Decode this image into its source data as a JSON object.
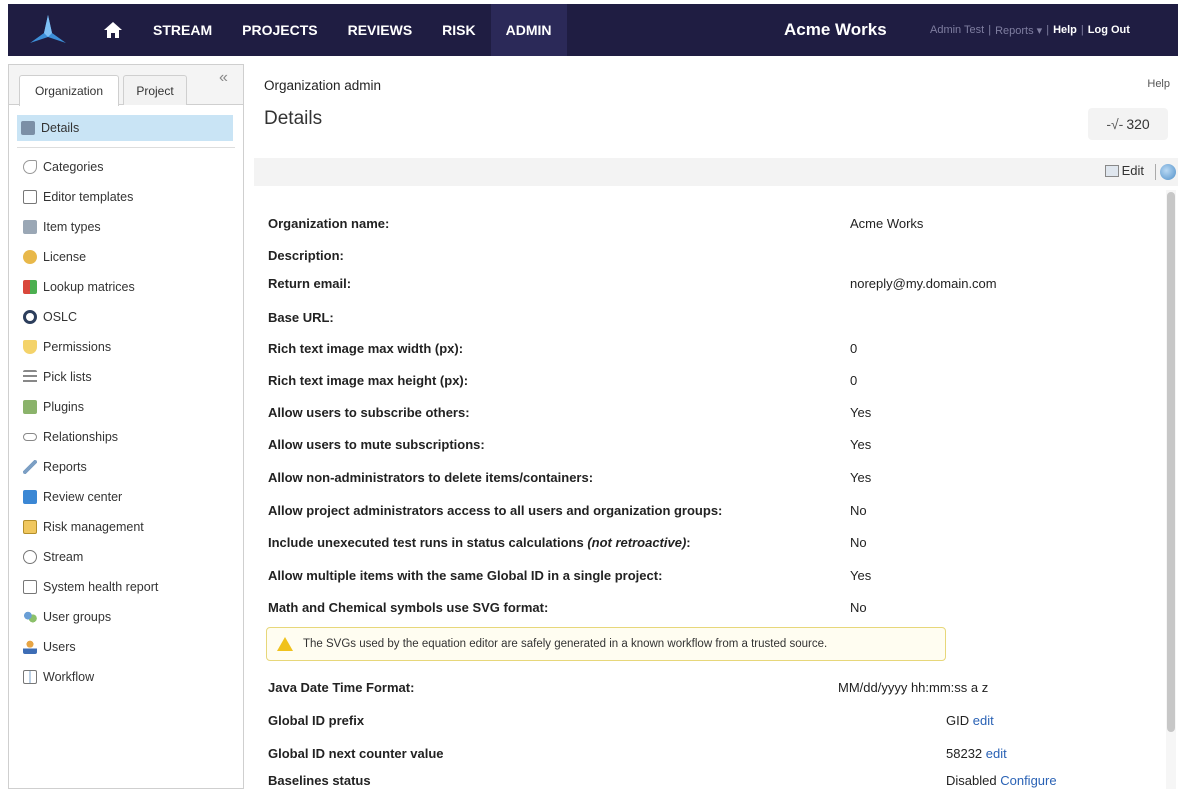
{
  "topbar": {
    "nav": [
      "STREAM",
      "PROJECTS",
      "REVIEWS",
      "RISK",
      "ADMIN"
    ],
    "brand": "Acme Works",
    "user": "Admin Test",
    "reports": "Reports",
    "help": "Help",
    "logout": "Log Out"
  },
  "sidebar": {
    "tabs": {
      "organization": "Organization",
      "project": "Project"
    },
    "items": [
      {
        "label": "Details",
        "icon": "details-icon"
      },
      {
        "label": "Categories",
        "icon": "categories-icon"
      },
      {
        "label": "Editor templates",
        "icon": "editor-templates-icon"
      },
      {
        "label": "Item types",
        "icon": "item-types-icon"
      },
      {
        "label": "License",
        "icon": "license-icon"
      },
      {
        "label": "Lookup matrices",
        "icon": "lookup-matrices-icon"
      },
      {
        "label": "OSLC",
        "icon": "oslc-icon"
      },
      {
        "label": "Permissions",
        "icon": "permissions-icon"
      },
      {
        "label": "Pick lists",
        "icon": "pick-lists-icon"
      },
      {
        "label": "Plugins",
        "icon": "plugins-icon"
      },
      {
        "label": "Relationships",
        "icon": "relationships-icon"
      },
      {
        "label": "Reports",
        "icon": "reports-icon"
      },
      {
        "label": "Review center",
        "icon": "review-center-icon"
      },
      {
        "label": "Risk management",
        "icon": "risk-management-icon"
      },
      {
        "label": "Stream",
        "icon": "stream-icon"
      },
      {
        "label": "System health report",
        "icon": "system-health-report-icon"
      },
      {
        "label": "User groups",
        "icon": "user-groups-icon"
      },
      {
        "label": "Users",
        "icon": "users-icon"
      },
      {
        "label": "Workflow",
        "icon": "workflow-icon"
      }
    ]
  },
  "main": {
    "breadcrumb": "Organization admin",
    "help": "Help",
    "title": "Details",
    "counter": "320",
    "edit": "Edit",
    "properties": [
      {
        "label": "Organization name:",
        "value": "Acme Works"
      },
      {
        "label": "Description:",
        "value": ""
      },
      {
        "label": "Return email:",
        "value": "noreply@my.domain.com"
      },
      {
        "label": "Base URL:",
        "value": ""
      },
      {
        "label": "Rich text image max width (px):",
        "value": "0"
      },
      {
        "label": "Rich text image max height (px):",
        "value": "0"
      },
      {
        "label": "Allow users to subscribe others:",
        "value": "Yes"
      },
      {
        "label": "Allow users to mute subscriptions:",
        "value": "Yes"
      },
      {
        "label": "Allow non-administrators to delete items/containers:",
        "value": "Yes"
      },
      {
        "label": "Allow project administrators access to all users and organization groups:",
        "value": "No"
      },
      {
        "label": "Include unexecuted test runs in status calculations",
        "label_note": "(not retroactive)",
        "label_end": ":",
        "value": "No"
      },
      {
        "label": "Allow multiple items with the same Global ID in a single project:",
        "value": "Yes"
      },
      {
        "label": "Math and Chemical symbols use SVG format:",
        "value": "No"
      }
    ],
    "warning": "The SVGs used by the equation editor are safely generated in a known workflow from a trusted source.",
    "properties2": [
      {
        "label": "Java Date Time Format:",
        "value": "MM/dd/yyyy hh:mm:ss a z"
      },
      {
        "label": "Global ID prefix",
        "value": "GID",
        "link": "edit"
      },
      {
        "label": "Global ID next counter value",
        "value": "58232",
        "link": "edit"
      },
      {
        "label": "Baselines status",
        "value": "Disabled",
        "link": "Configure"
      }
    ]
  }
}
